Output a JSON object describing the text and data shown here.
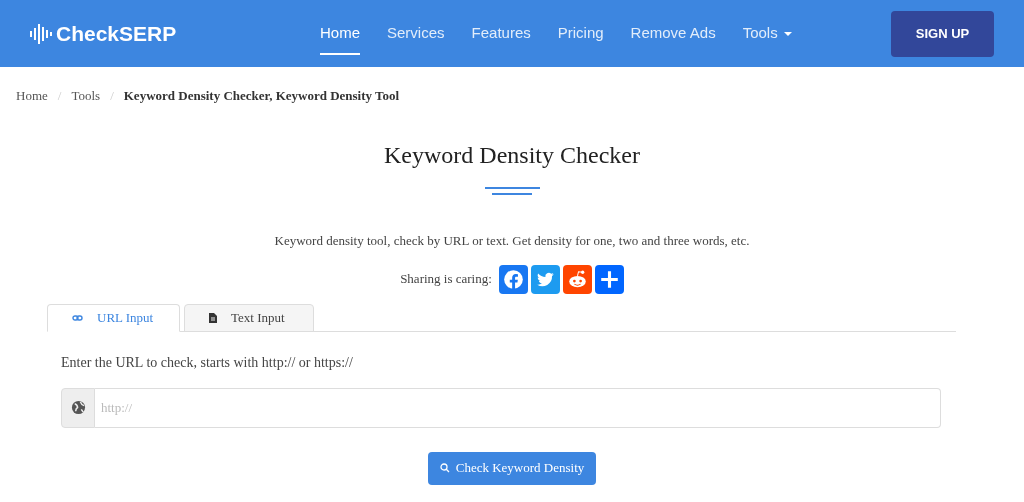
{
  "header": {
    "logo": "CheckSERP",
    "nav": [
      {
        "label": "Home",
        "selected": true
      },
      {
        "label": "Services",
        "selected": false
      },
      {
        "label": "Features",
        "selected": false
      },
      {
        "label": "Pricing",
        "selected": false
      },
      {
        "label": "Remove Ads",
        "selected": false
      },
      {
        "label": "Tools",
        "selected": false,
        "dropdown": true
      }
    ],
    "signup": "SIGN UP"
  },
  "breadcrumb_separator": "/",
  "breadcrumb": [
    {
      "label": "Home",
      "current": false
    },
    {
      "label": "Tools",
      "current": false
    },
    {
      "label": "Keyword Density Checker, Keyword Density Tool",
      "current": true
    }
  ],
  "title": "Keyword Density Checker",
  "description": "Keyword density tool, check by URL or text. Get density for one, two and three words, etc.",
  "sharing": {
    "label": "Sharing is caring:",
    "buttons": [
      {
        "kind": "facebook"
      },
      {
        "kind": "twitter"
      },
      {
        "kind": "reddit"
      },
      {
        "kind": "more"
      }
    ]
  },
  "tabs": [
    {
      "label": "URL Input",
      "kind": "link",
      "selected": true
    },
    {
      "label": "Text Input",
      "kind": "file",
      "selected": false
    }
  ],
  "form": {
    "label": "Enter the URL to check, starts with http:// or https://",
    "placeholder": "http://",
    "button": "Check Keyword Density"
  }
}
